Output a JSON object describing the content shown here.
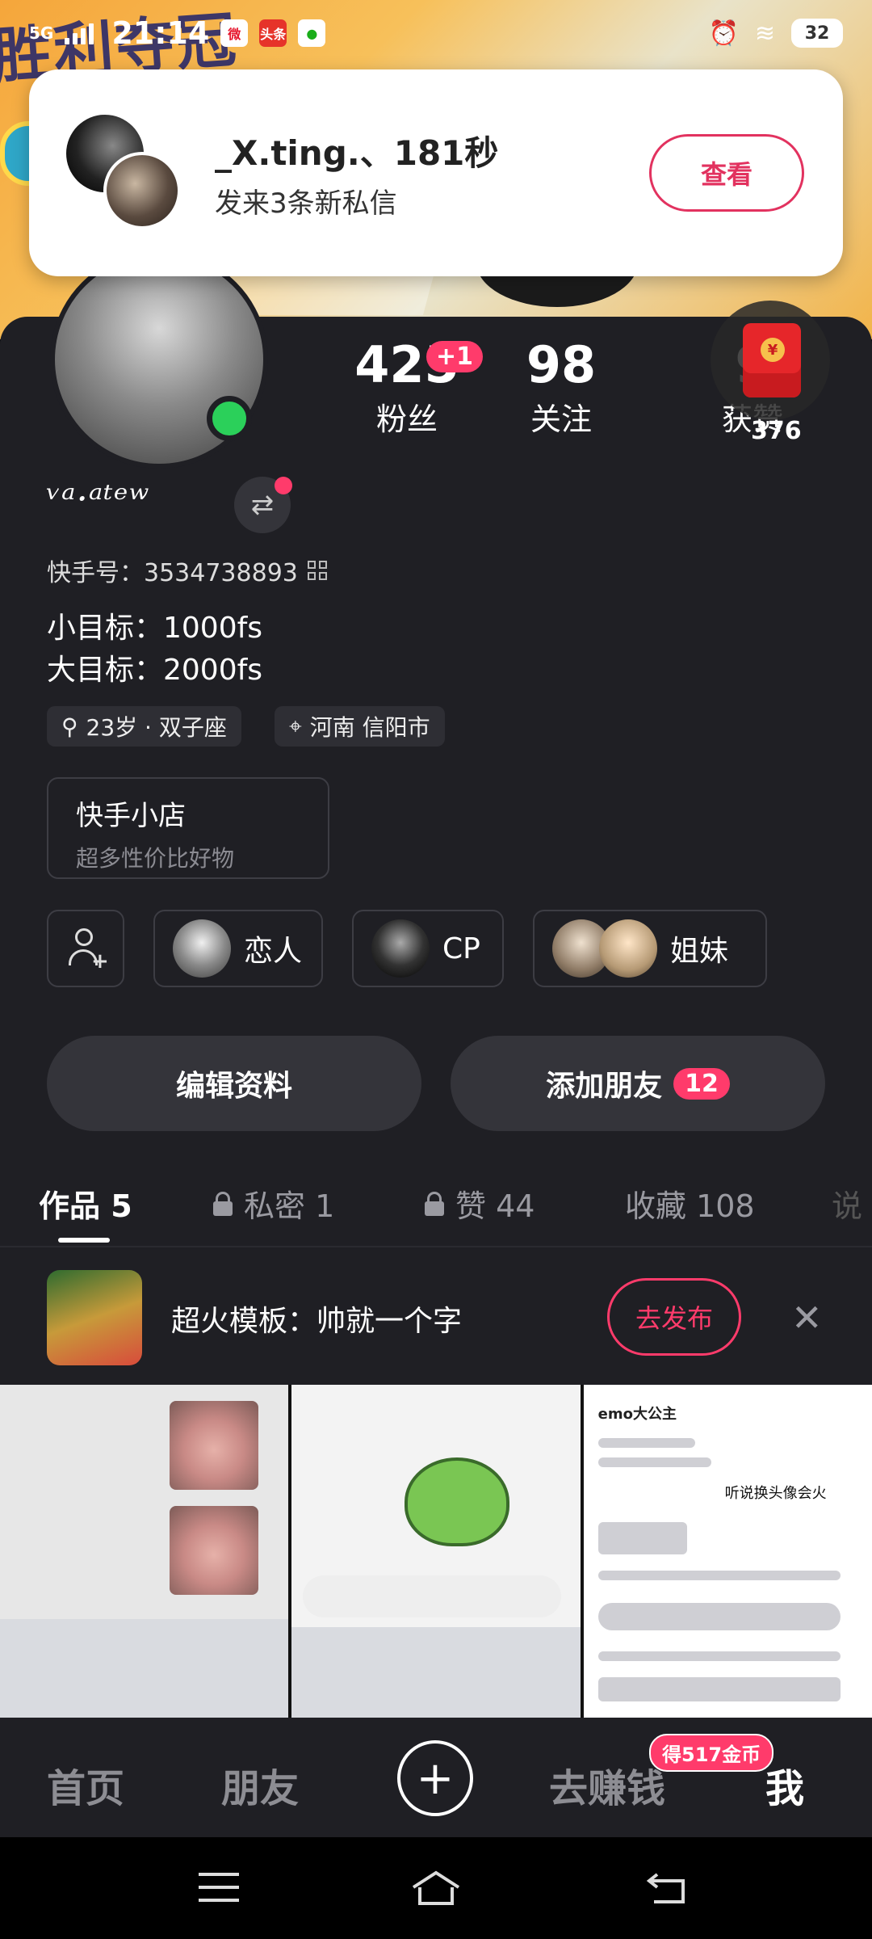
{
  "status_bar": {
    "network": "5G",
    "time": "21:14",
    "battery": "32",
    "app_icons": [
      "weibo-icon",
      "toutiao-icon",
      "wechat-icon"
    ],
    "toutiao_label": "头条"
  },
  "notification": {
    "sender": "_X.ting.、181秒",
    "message": "发来3条新私信",
    "button": "查看"
  },
  "profile": {
    "nickname": "ᵛᵃ·ᵃᵗᵉʷ",
    "kuaishou_id_label": "快手号：3534738893",
    "goal_small": "小目标：1000fs",
    "goal_big": "大目标：2000fs",
    "tag_age": "23岁 · 双子座",
    "tag_location": "河南 信阳市",
    "stats": {
      "fans": "425",
      "fans_label": "粉丝",
      "fans_badge": "+1",
      "following": "98",
      "following_label": "关注",
      "likes_label": "获赞",
      "likes_partial": "9",
      "likes_extra": "376"
    }
  },
  "shop": {
    "title": "快手小店",
    "subtitle": "超多性价比好物"
  },
  "relations": {
    "lover": "恋人",
    "cp": "CP",
    "sisters": "姐妹"
  },
  "actions": {
    "edit": "编辑资料",
    "add_friend": "添加朋友",
    "add_friend_badge": "12"
  },
  "tabs": {
    "works": "作品 5",
    "private": "私密 1",
    "likes": "赞 44",
    "favorites": "收藏 108",
    "more": "说"
  },
  "promo": {
    "text": "超火模板：帅就一个字",
    "button": "去发布",
    "close": "✕"
  },
  "thumbnails": {
    "cell3_title": "emo大公主",
    "cell3_caption": "听说换头像会火"
  },
  "bottom_nav": {
    "home": "首页",
    "friends": "朋友",
    "plus": "+",
    "earn": "去赚钱",
    "coin_badge": "得517金币",
    "me": "我"
  },
  "colors": {
    "accent": "#ff3b6b",
    "panel_bg": "#1f1f24",
    "online": "#2bd05a"
  }
}
